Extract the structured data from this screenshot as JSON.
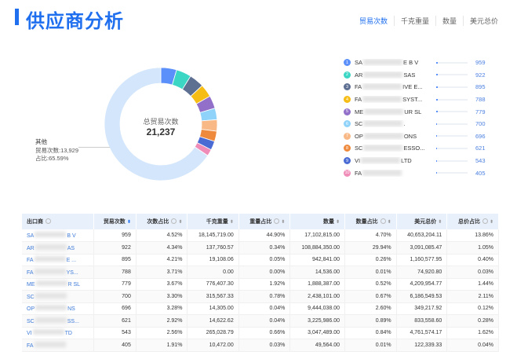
{
  "header": {
    "title": "供应商分析",
    "tabs": [
      {
        "label": "贸易次数",
        "active": true
      },
      {
        "label": "千克重量"
      },
      {
        "label": "数量"
      },
      {
        "label": "美元总价"
      }
    ]
  },
  "donut": {
    "center_label": "总贸易次数",
    "center_value": "21,237",
    "other": {
      "title": "其他",
      "count_text": "贸易次数:13,929",
      "share_text": "占比:65.59%",
      "value": 13929,
      "color": "#d3e6fb"
    }
  },
  "colors": [
    "#5b8ff9",
    "#3cd6c5",
    "#5d7092",
    "#f6bd16",
    "#9270ca",
    "#8fd3fa",
    "#f8b987",
    "#ef8a3c",
    "#4a6bd4",
    "#f08cb8"
  ],
  "legend": [
    {
      "prefix": "SA",
      "suffix": "E B V",
      "value": 959
    },
    {
      "prefix": "AR",
      "suffix": "SAS",
      "value": 922
    },
    {
      "prefix": "FA",
      "suffix": "IVE E...",
      "value": 895
    },
    {
      "prefix": "FA",
      "suffix": "SYST...",
      "value": 788
    },
    {
      "prefix": "ME",
      "suffix": "UR SL",
      "value": 779
    },
    {
      "prefix": "SC",
      "suffix": ".",
      "value": 700
    },
    {
      "prefix": "OP",
      "suffix": "ONS",
      "value": 696
    },
    {
      "prefix": "SC",
      "suffix": "ESSO...",
      "value": 621
    },
    {
      "prefix": "VI",
      "suffix": "LTD",
      "value": 543
    },
    {
      "prefix": "FA",
      "suffix": "",
      "value": 405
    }
  ],
  "table": {
    "columns": [
      "出口商",
      "贸易次数",
      "次数占比",
      "千克重量",
      "重量占比",
      "数量",
      "数量占比",
      "美元总价",
      "总价占比"
    ],
    "rows": [
      {
        "prefix": "SA",
        "suffix": "B V",
        "cells": [
          "959",
          "4.52%",
          "18,145,719.00",
          "44.90%",
          "17,102,815.00",
          "4.70%",
          "40,653,204.11",
          "13.86%"
        ]
      },
      {
        "prefix": "AR",
        "suffix": "AS",
        "cells": [
          "922",
          "4.34%",
          "137,760.57",
          "0.34%",
          "108,884,350.00",
          "29.94%",
          "3,091,085.47",
          "1.05%"
        ]
      },
      {
        "prefix": "FA",
        "suffix": "E ...",
        "cells": [
          "895",
          "4.21%",
          "19,108.06",
          "0.05%",
          "942,841.00",
          "0.26%",
          "1,160,577.95",
          "0.40%"
        ]
      },
      {
        "prefix": "FA",
        "suffix": "YS...",
        "cells": [
          "788",
          "3.71%",
          "0.00",
          "0.00%",
          "14,536.00",
          "0.01%",
          "74,920.80",
          "0.03%"
        ]
      },
      {
        "prefix": "ME",
        "suffix": "R SL",
        "cells": [
          "779",
          "3.67%",
          "776,407.30",
          "1.92%",
          "1,888,387.00",
          "0.52%",
          "4,209,954.77",
          "1.44%"
        ]
      },
      {
        "prefix": "SC",
        "suffix": "",
        "cells": [
          "700",
          "3.30%",
          "315,567.33",
          "0.78%",
          "2,438,101.00",
          "0.67%",
          "6,186,549.53",
          "2.11%"
        ]
      },
      {
        "prefix": "OP",
        "suffix": "NS",
        "cells": [
          "696",
          "3.28%",
          "14,305.00",
          "0.04%",
          "9,444,038.00",
          "2.60%",
          "349,217.92",
          "0.12%"
        ]
      },
      {
        "prefix": "SC",
        "suffix": "SS...",
        "cells": [
          "621",
          "2.92%",
          "14,622.62",
          "0.04%",
          "3,225,986.00",
          "0.89%",
          "833,558.60",
          "0.28%"
        ]
      },
      {
        "prefix": "VI",
        "suffix": "TD",
        "cells": [
          "543",
          "2.56%",
          "265,028.79",
          "0.66%",
          "3,047,489.00",
          "0.84%",
          "4,761,574.17",
          "1.62%"
        ]
      },
      {
        "prefix": "FA",
        "suffix": "",
        "cells": [
          "405",
          "1.91%",
          "10,472.00",
          "0.03%",
          "49,564.00",
          "0.01%",
          "122,339.33",
          "0.04%"
        ]
      }
    ]
  }
}
